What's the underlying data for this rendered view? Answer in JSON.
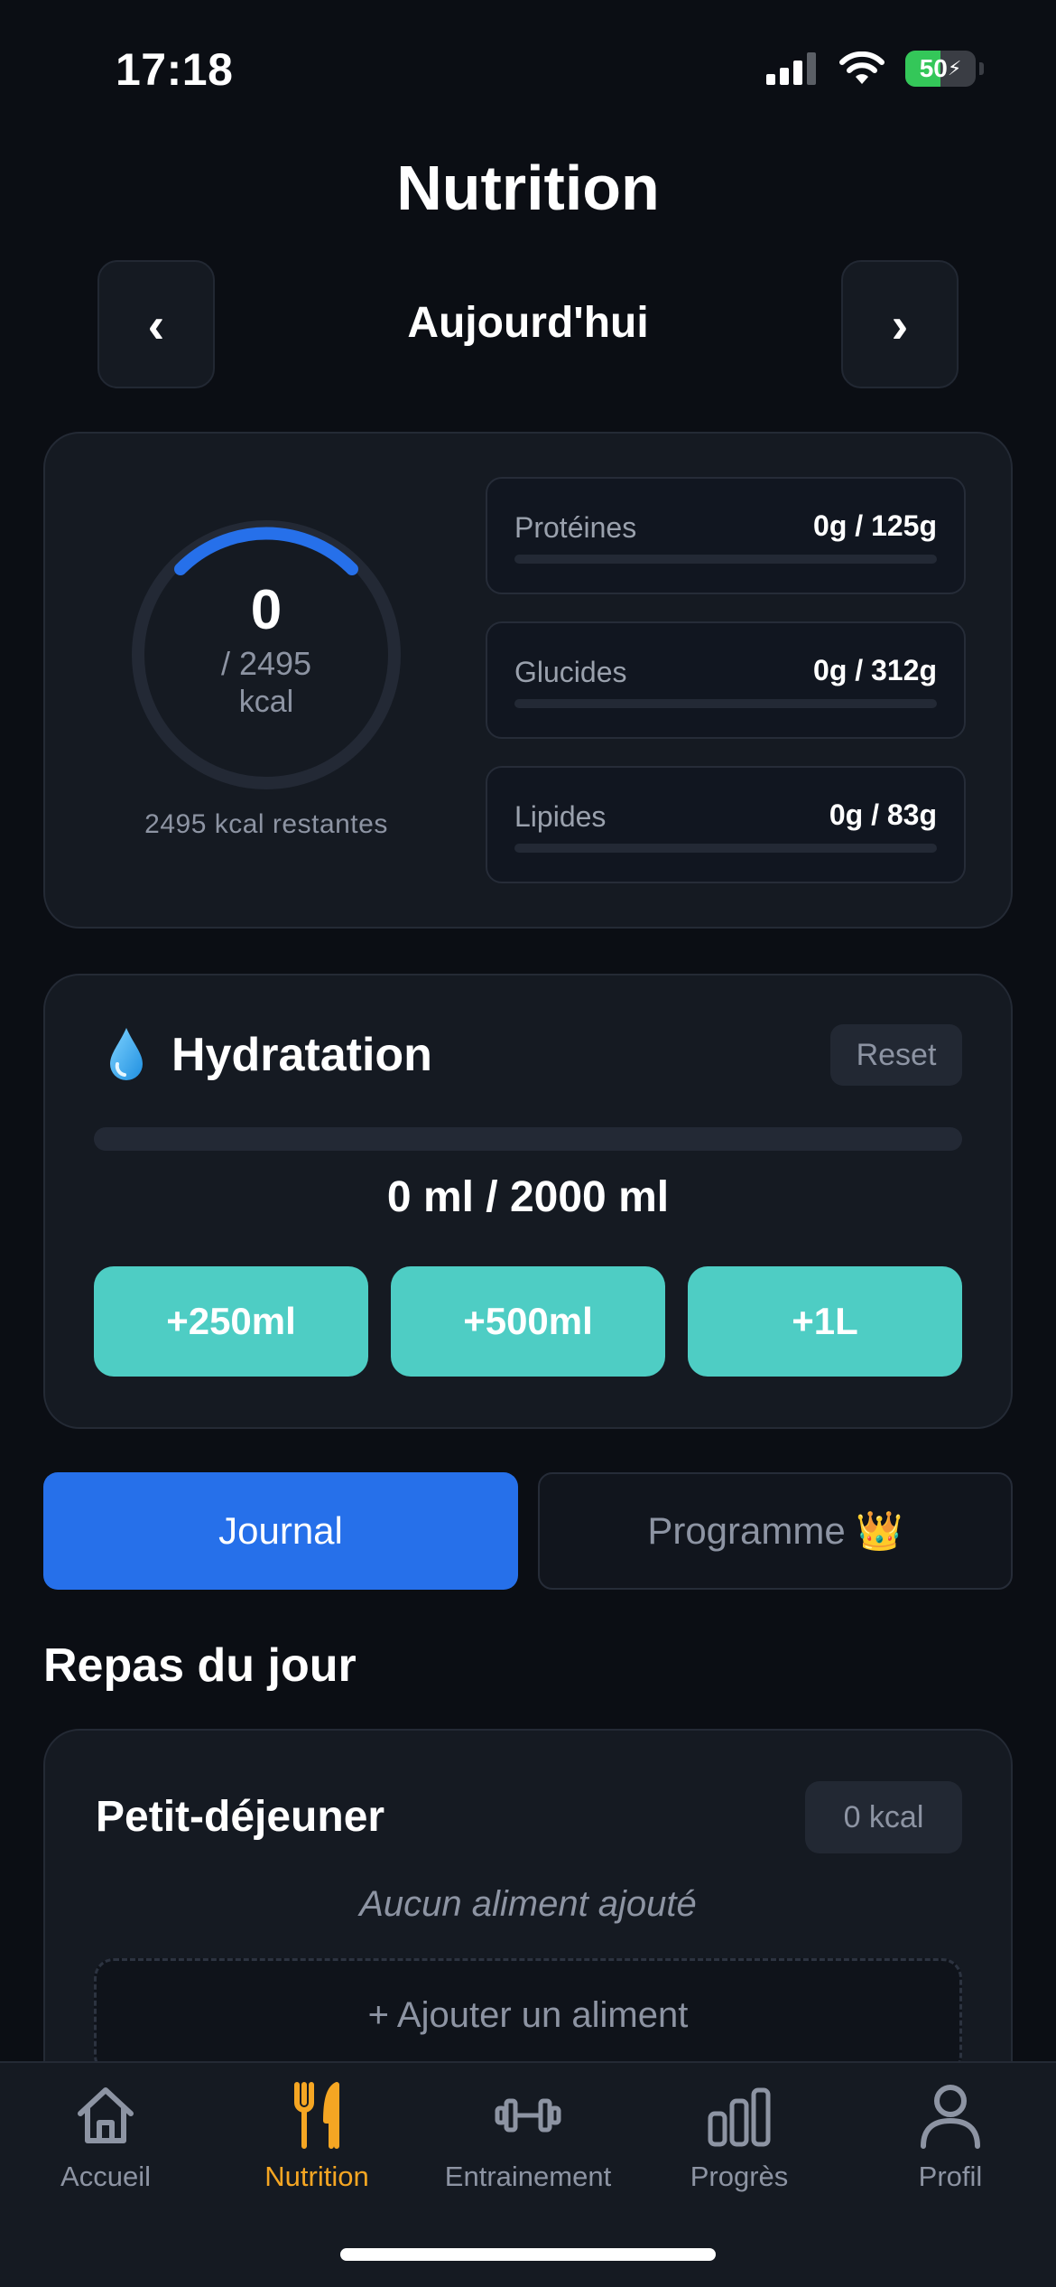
{
  "status_bar": {
    "time": "17:18",
    "battery": "50",
    "battery_level": 0.5
  },
  "header": {
    "title": "Nutrition"
  },
  "date_nav": {
    "prev_label": "‹",
    "next_label": "›",
    "current": "Aujourd'hui"
  },
  "calories": {
    "consumed": "0",
    "target": "/ 2495",
    "unit": "kcal",
    "remaining": "2495 kcal restantes",
    "progress": 0
  },
  "macros": [
    {
      "label": "Protéines",
      "value": "0g / 125g",
      "progress": 0
    },
    {
      "label": "Glucides",
      "value": "0g / 312g",
      "progress": 0
    },
    {
      "label": "Lipides",
      "value": "0g / 83g",
      "progress": 0
    }
  ],
  "hydration": {
    "title": "Hydratation",
    "reset_label": "Reset",
    "amount": "0 ml / 2000 ml",
    "progress": 0,
    "buttons": [
      "+250ml",
      "+500ml",
      "+1L"
    ]
  },
  "tabs": {
    "journal": "Journal",
    "programme": "Programme 👑"
  },
  "meals_section": {
    "title": "Repas du jour"
  },
  "meal": {
    "name": "Petit-déjeuner",
    "kcal": "0 kcal",
    "empty_text": "Aucun aliment ajouté",
    "add_label": "+ Ajouter un aliment"
  },
  "bottom_nav": [
    {
      "label": "Accueil",
      "icon": "home-icon"
    },
    {
      "label": "Nutrition",
      "icon": "fork-knife-icon",
      "active": true
    },
    {
      "label": "Entrainement",
      "icon": "dumbbell-icon"
    },
    {
      "label": "Progrès",
      "icon": "bar-chart-icon"
    },
    {
      "label": "Profil",
      "icon": "user-icon"
    }
  ],
  "colors": {
    "accent_blue": "#2670ea",
    "water": "#4ecdc4",
    "nav_active": "#f5a623",
    "background": "#0b0e14",
    "card": "#151a22"
  }
}
